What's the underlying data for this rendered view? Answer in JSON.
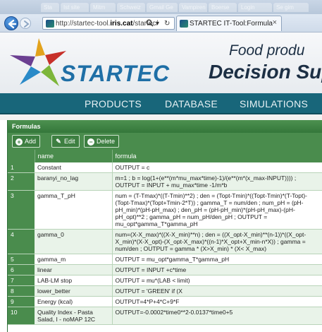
{
  "browser": {
    "blurred_tabs": [
      "Sta  ",
      "Ist  site",
      "Mitm  ",
      "Schweiz",
      "Gmail Ge  ",
      "Vampiren",
      "Boerse  ",
      "Login  ",
      "Se gim"
    ],
    "url_prefix": "http://startec-tool.",
    "url_host": "iris.cat",
    "url_suffix": "/startec/",
    "address_icons": [
      "search-icon",
      "refresh-icon"
    ],
    "tab_title": "STARTEC IT-Tool:Formula",
    "tab_close": "×"
  },
  "brand": {
    "logo_text": "STARTEC",
    "tagline_line1": "Food produ",
    "tagline_line2": "Decision Supp",
    "colors": {
      "logo_blue": "#1f6fa6",
      "nav_teal": "#18667a",
      "panel_green": "#4a8c4d"
    }
  },
  "nav": {
    "items": [
      "PRODUCTS",
      "DATABASE",
      "SIMULATIONS"
    ]
  },
  "panel": {
    "title": "Formulas",
    "buttons": {
      "add": "Add",
      "edit": "Edit",
      "delete": "Delete"
    },
    "columns": {
      "name": "name",
      "formula": "formula"
    },
    "rows": [
      {
        "id": "1",
        "name": "Constant",
        "formula": "OUTPUT = c"
      },
      {
        "id": "2",
        "name": "baranyi_no_lag",
        "formula": "m=1 ; b = log(1+(e**(m*mu_max*time)-1)/(e**(m*(x_max-INPUT)))) ; OUTPUT = INPUT + mu_max*time -1/m*b"
      },
      {
        "id": "3",
        "name": "gamma_T_pH",
        "formula": "num = (T-Tmax)*((T-Tmin)**2) ; den = (Topt-Tmin)*((Topt-Tmin)*(T-Topt)-(Topt-Tmax)*(Topt+Tmin-2*T)) ; gamma_T = num/den ; num_pH = (pH-pH_min)*(pH-pH_max) ; den_pH = (pH-pH_min)*(pH-pH_max)-(pH-pH_opt)**2 ; gamma_pH = num_pH/den_pH ; OUTPUT = mu_opt*gamma_T*gamma_pH"
      },
      {
        "id": "4",
        "name": "gamma_0",
        "formula": "num=(X-X_max)*((X-X_min)**n) ; den = ((X_opt-X_min)**(n-1))*((X_opt-X_min)*(X-X_opt)-(X_opt-X_max)*((n-1)*X_opt+X_min-n*X)) ; gamma = num/den ; OUTPUT = gamma * (X>X_min) * (X< X_max)"
      },
      {
        "id": "5",
        "name": "gamma_m",
        "formula": "OUTPUT = mu_opt*gamma_T*gamma_pH"
      },
      {
        "id": "6",
        "name": "linear",
        "formula": "OUTPUT = INPUT +c*time"
      },
      {
        "id": "7",
        "name": "LAB-LM stop",
        "formula": "OUTPUT = mu*(LAB < limit)"
      },
      {
        "id": "8",
        "name": "lower_better",
        "formula": "OUTPUT = 'GREEN' if (X"
      },
      {
        "id": "9",
        "name": "Energy (kcal)",
        "formula": "OUTPUT=4*P+4*C+9*F"
      },
      {
        "id": "10",
        "name": "Quality Index - Pasta Salad, I - noMAP 12C",
        "formula": "OUTPUT=-0.0002*time0**2-0.0137*time0+5"
      }
    ]
  }
}
